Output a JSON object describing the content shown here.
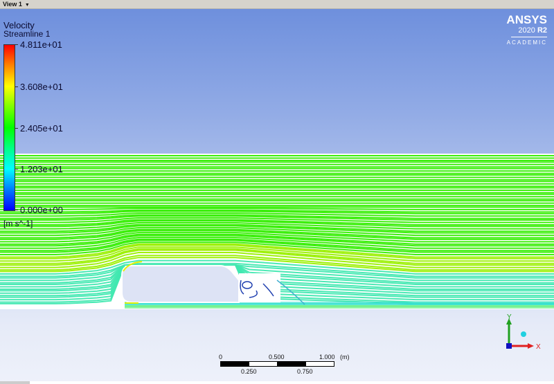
{
  "view_tab": {
    "label": "View 1",
    "dropdown_icon": "triangle-down-icon"
  },
  "legend": {
    "title": "Velocity",
    "subtitle": "Streamline 1",
    "labels": [
      "4.811e+01",
      "3.608e+01",
      "2.405e+01",
      "1.203e+01",
      "0.000e+00"
    ],
    "units": "[m s^-1]",
    "colormap": [
      "#ff0000",
      "#ffff00",
      "#00ff00",
      "#00ffff",
      "#0000ff"
    ]
  },
  "logo": {
    "brand": "ANSYS",
    "version": "2020",
    "release": "R2",
    "edition": "ACADEMIC"
  },
  "scale_bar": {
    "top_labels": [
      "0",
      "0.500",
      "1.000"
    ],
    "unit": "(m)",
    "bottom_labels": [
      "0.250",
      "0.750"
    ]
  },
  "axes_triad": {
    "x_label": "X",
    "y_label": "Y",
    "x_color": "#e02020",
    "y_color": "#20a020",
    "origin_color": "#1010c0"
  },
  "colors": {
    "streamline_main": "#33ee00",
    "body_fill": "#dde3f5"
  }
}
